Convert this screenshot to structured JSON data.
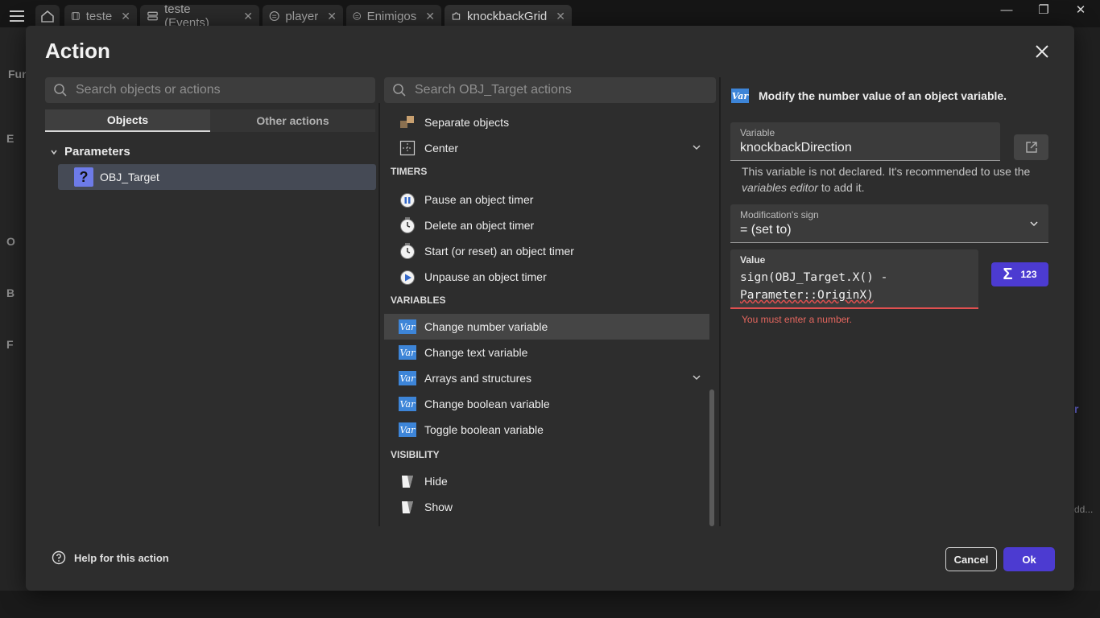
{
  "app_tabs": [
    {
      "label": "teste"
    },
    {
      "label": "teste (Events)"
    },
    {
      "label": "player"
    },
    {
      "label": "Enimigos"
    },
    {
      "label": "knockbackGrid"
    }
  ],
  "background": {
    "left_labels": [
      "Fun",
      "E",
      "O",
      "B",
      "F"
    ],
    "right_labels": [
      "r",
      "dd..."
    ]
  },
  "dialog": {
    "title": "Action",
    "left": {
      "search_placeholder": "Search objects or actions",
      "tabs": [
        "Objects",
        "Other actions"
      ],
      "group_label": "Parameters",
      "object": "OBJ_Target"
    },
    "middle": {
      "search_placeholder": "Search OBJ_Target actions",
      "items_top": [
        {
          "label": "Separate objects",
          "icon": "separate-icon"
        },
        {
          "label": "Center",
          "icon": "center-icon"
        }
      ],
      "sections": {
        "timers": "TIMERS",
        "variables": "VARIABLES",
        "visibility": "VISIBILITY"
      },
      "timers": [
        {
          "label": "Pause an object timer",
          "icon": "pause-timer-icon"
        },
        {
          "label": "Delete an object timer",
          "icon": "timer-icon"
        },
        {
          "label": "Start (or reset) an object timer",
          "icon": "timer-icon"
        },
        {
          "label": "Unpause an object timer",
          "icon": "unpause-timer-icon"
        }
      ],
      "variables": [
        {
          "label": "Change number variable",
          "icon": "var-icon",
          "selected": true
        },
        {
          "label": "Change text variable",
          "icon": "var-icon"
        },
        {
          "label": "Arrays and structures",
          "icon": "var-icon"
        },
        {
          "label": "Change boolean variable",
          "icon": "var-icon"
        },
        {
          "label": "Toggle boolean variable",
          "icon": "var-icon"
        }
      ],
      "visibility": [
        {
          "label": "Hide",
          "icon": "visibility-icon"
        },
        {
          "label": "Show",
          "icon": "visibility-icon"
        }
      ],
      "var_icon_text": "Var"
    },
    "right": {
      "description": "Modify the number value of an object variable.",
      "variable_label": "Variable",
      "variable_value": "knockbackDirection",
      "hint_pre": "This variable is not declared. It's recommended to use the ",
      "hint_em": "variables editor",
      "hint_post": " to add it.",
      "sign_label": "Modification's sign",
      "sign_value": "= (set to)",
      "value_label": "Value",
      "value_line1": "sign(OBJ_Target.X() -",
      "value_line2": "Parameter::OriginX)",
      "error": "You must enter a number.",
      "expr_button": "123"
    },
    "footer": {
      "help": "Help for this action",
      "cancel": "Cancel",
      "ok": "Ok"
    }
  },
  "colors": {
    "accent": "#4c3bd1",
    "error": "#e05050",
    "var_blue": "#3d85d8"
  }
}
